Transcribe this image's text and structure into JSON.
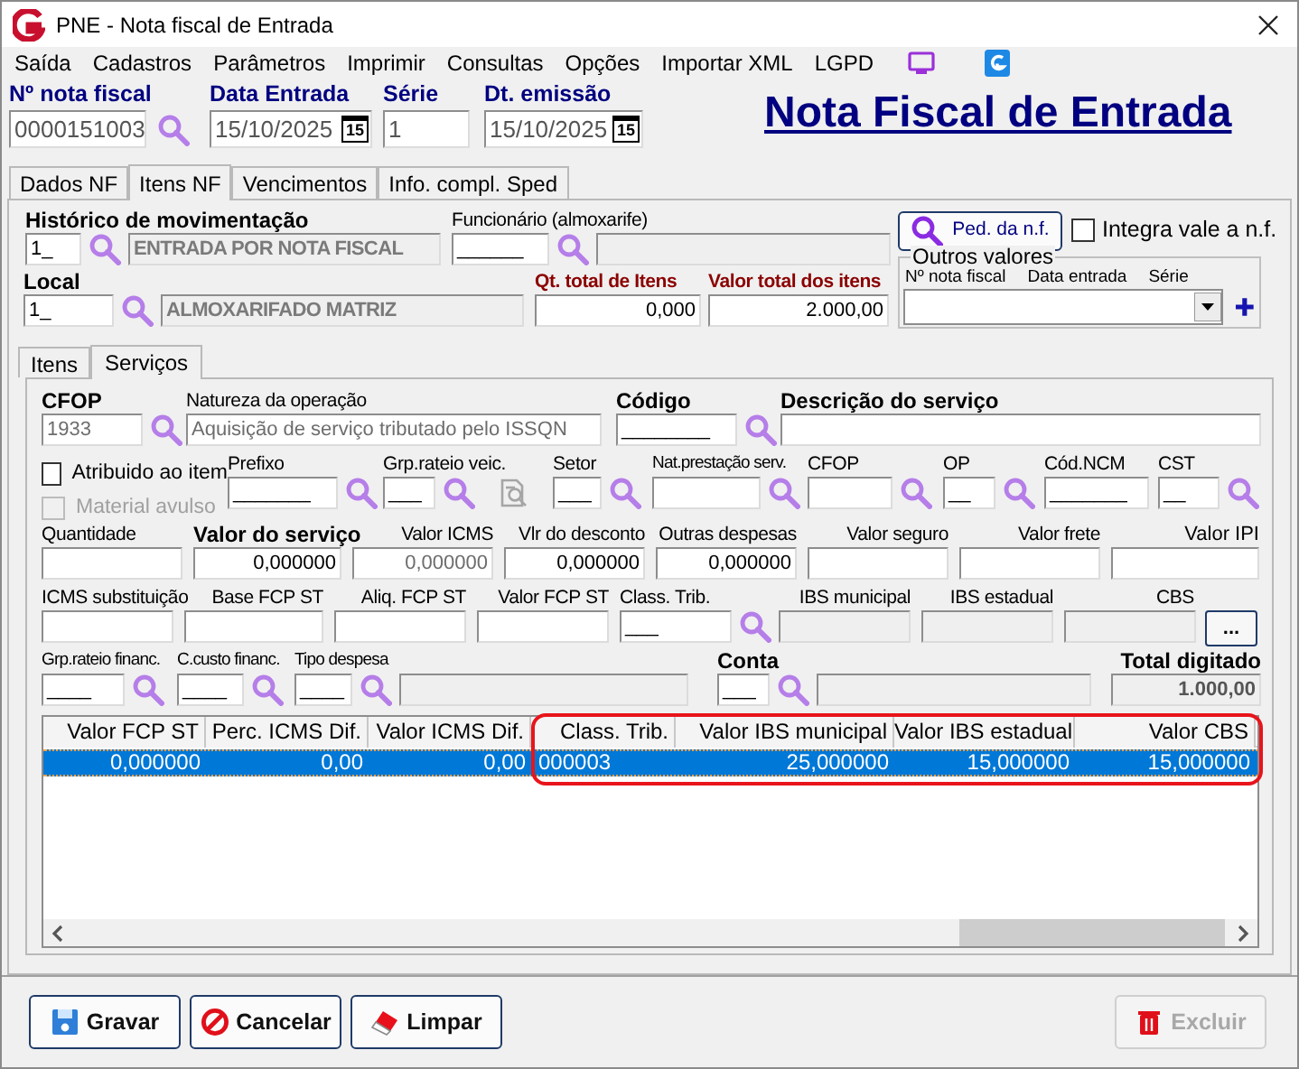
{
  "window": {
    "title": "PNE - Nota fiscal de Entrada"
  },
  "menu": [
    {
      "label": "Saída"
    },
    {
      "label": "Cadastros"
    },
    {
      "label": "Parâmetros"
    },
    {
      "label": "Imprimir"
    },
    {
      "label": "Consultas"
    },
    {
      "label": "Opções"
    },
    {
      "label": "Importar XML"
    },
    {
      "label": "LGPD"
    }
  ],
  "header_fields": [
    {
      "label": "Nº nota fiscal",
      "value": "0000151003",
      "kind": "lookup"
    },
    {
      "label": "Data Entrada",
      "value": "15/10/2025",
      "kind": "date",
      "calendar": "15"
    },
    {
      "label": "Série",
      "value": "1",
      "kind": "text"
    },
    {
      "label": "Dt. emissão",
      "value": "15/10/2025",
      "kind": "date",
      "calendar": "15"
    }
  ],
  "form_title": "Nota Fiscal de Entrada",
  "tabs": [
    {
      "label": "Dados NF",
      "selected": false
    },
    {
      "label": "Itens NF",
      "selected": true
    },
    {
      "label": "Vencimentos",
      "selected": false
    },
    {
      "label": "Info. compl. Sped",
      "selected": false
    }
  ],
  "movement_rows": [
    [
      {
        "label": "Histórico de movimentação",
        "kind": "lookup_desc",
        "value": "1_",
        "description": "ENTRADA POR NOTA FISCAL"
      },
      {
        "label": "Funcionário (almoxarife)",
        "kind": "lookup_desc",
        "value": "______"
      }
    ],
    [
      {
        "label": "Local",
        "kind": "lookup_desc",
        "value": "1_",
        "description": "ALMOXARIFADO MATRIZ"
      },
      {
        "label": "Qt. total de Itens",
        "kind": "number",
        "value": "0,000"
      },
      {
        "label": "Valor total dos itens",
        "kind": "number",
        "value": "2.000,00"
      }
    ]
  ],
  "order_button": {
    "label": "Ped. da n.f."
  },
  "integra_checkbox": {
    "label": "Integra vale a n.f.",
    "checked": false
  },
  "outros_valores": {
    "legend": "Outros valores",
    "columns": [
      "Nº nota fiscal",
      "Data entrada",
      "Série"
    ]
  },
  "inner_tabs": [
    {
      "label": "Itens",
      "selected": false
    },
    {
      "label": "Serviços",
      "selected": true
    }
  ],
  "service_rows": [
    [
      {
        "label": "CFOP",
        "kind": "dim_lookup",
        "value": "1933"
      },
      {
        "label": "Natureza da operação",
        "kind": "dim_text",
        "value": "Aquisição de serviço tributado pelo ISSQN"
      },
      {
        "label": "Código",
        "kind": "lookup",
        "value": "________"
      },
      {
        "label": "Descrição do serviço",
        "kind": "text"
      }
    ],
    [
      {
        "kind": "checks",
        "items": [
          {
            "label": "Atribuido ao item",
            "checked": false,
            "disabled": false
          },
          {
            "label": "Material avulso",
            "checked": false,
            "disabled": true
          }
        ]
      },
      {
        "label": "Prefixo",
        "kind": "lookup",
        "value": "_______"
      },
      {
        "label": "Grp.rateio veic.",
        "kind": "lookup_doc",
        "value": "___"
      },
      {
        "label": "Setor",
        "kind": "lookup",
        "value": "___"
      },
      {
        "label": "Nat.prestação serv.",
        "kind": "lookup"
      },
      {
        "label": "CFOP",
        "kind": "lookup"
      },
      {
        "label": "OP",
        "kind": "lookup",
        "value": "__"
      },
      {
        "label": "Cód.NCM",
        "kind": "text",
        "value": "_______"
      },
      {
        "label": "CST",
        "kind": "lookup",
        "value": "__"
      }
    ],
    [
      {
        "label": "Quantidade",
        "kind": "text"
      },
      {
        "label": "Valor do serviço",
        "kind": "number",
        "value": "0,000000"
      },
      {
        "label": "Valor ICMS",
        "kind": "dim_number",
        "value": "0,000000"
      },
      {
        "label": "Vlr do desconto",
        "kind": "number",
        "value": "0,000000"
      },
      {
        "label": "Outras despesas",
        "kind": "number",
        "value": "0,000000"
      },
      {
        "label": "Valor seguro",
        "kind": "text"
      },
      {
        "label": "Valor frete",
        "kind": "text"
      },
      {
        "label": "Valor IPI",
        "kind": "text"
      }
    ],
    [
      {
        "label": "ICMS substituição",
        "kind": "text"
      },
      {
        "label": "Base FCP ST",
        "kind": "text"
      },
      {
        "label": "Aliq. FCP ST",
        "kind": "text"
      },
      {
        "label": "Valor FCP ST",
        "kind": "text"
      },
      {
        "label": "Class. Trib.",
        "kind": "lookup",
        "value": "___"
      },
      {
        "label": "IBS municipal",
        "kind": "readonly"
      },
      {
        "label": "IBS estadual",
        "kind": "readonly"
      },
      {
        "label": "CBS",
        "kind": "readonly"
      },
      {
        "kind": "button",
        "value": "..."
      }
    ],
    [
      {
        "label": "Grp.rateio financ.",
        "kind": "lookup",
        "value": "____"
      },
      {
        "label": "C.custo financ.",
        "kind": "lookup",
        "value": "____"
      },
      {
        "label": "Tipo despesa",
        "kind": "lookup_desc",
        "value": "____"
      },
      {
        "label": "Conta",
        "kind": "lookup_desc",
        "value": "___"
      },
      {
        "label": "Total digitado",
        "kind": "readonly_number",
        "value": "1.000,00"
      }
    ]
  ],
  "grid": {
    "columns": [
      "Valor FCP ST",
      "Perc. ICMS Dif.",
      "Valor ICMS Dif.",
      "Class. Trib.",
      "Valor IBS municipal",
      "Valor IBS estadual",
      "Valor CBS"
    ],
    "rows": [
      {
        "selected": true,
        "cells": [
          "0,000000",
          "0,00",
          "0,00",
          "000003",
          "25,000000",
          "15,000000",
          "15,000000"
        ]
      }
    ]
  },
  "buttons": [
    {
      "label": "Gravar",
      "kind": "save",
      "disabled": false
    },
    {
      "label": "Cancelar",
      "kind": "cancel",
      "disabled": false
    },
    {
      "label": "Limpar",
      "kind": "clear",
      "disabled": false
    },
    {
      "label": "Excluir",
      "kind": "delete",
      "disabled": true
    }
  ]
}
